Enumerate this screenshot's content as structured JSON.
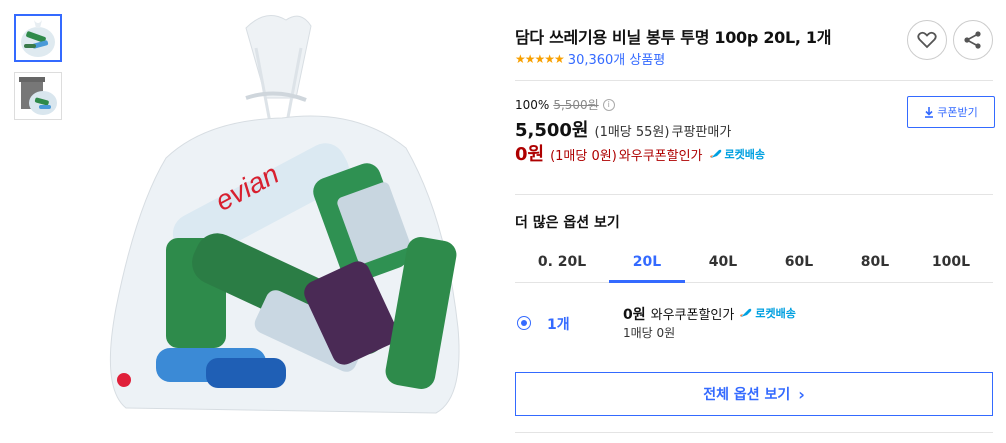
{
  "thumbnails": [
    {
      "alt": "bag-with-bottles"
    },
    {
      "alt": "bin-with-bag"
    }
  ],
  "product": {
    "title": "담다 쓰레기용 비닐 봉투 투명 100p 20L, 1개",
    "stars": "★★★★★",
    "review_count": "30,360개 상품평"
  },
  "price": {
    "discount_rate": "100%",
    "original_price": "5,500원",
    "info_icon": "i",
    "sale_price": "5,500원",
    "sale_unit": "(1매당 55원)",
    "sale_tag": "쿠팡판매가",
    "coupon_price": "0원",
    "coupon_unit": "(1매당 0원)",
    "coupon_tag": "와우쿠폰할인가",
    "rocket_label": "로켓배송"
  },
  "coupon_button": {
    "label": "쿠폰받기"
  },
  "options": {
    "title": "더 많은 옵션 보기",
    "tabs": [
      "0. 20L",
      "20L",
      "40L",
      "60L",
      "80L",
      "100L"
    ],
    "active_tab": 1,
    "selected": {
      "label": "1개",
      "price": "0원",
      "price_tag": "와우쿠폰할인가",
      "rocket_label": "로켓배송",
      "unit": "1매당 0원"
    }
  },
  "all_options_button": {
    "label": "전체 옵션 보기",
    "chevron": "›"
  },
  "colors": {
    "accent": "#346aff",
    "sale_red": "#ae0000",
    "star": "#f8a000",
    "rocket": "#00a0e0"
  }
}
